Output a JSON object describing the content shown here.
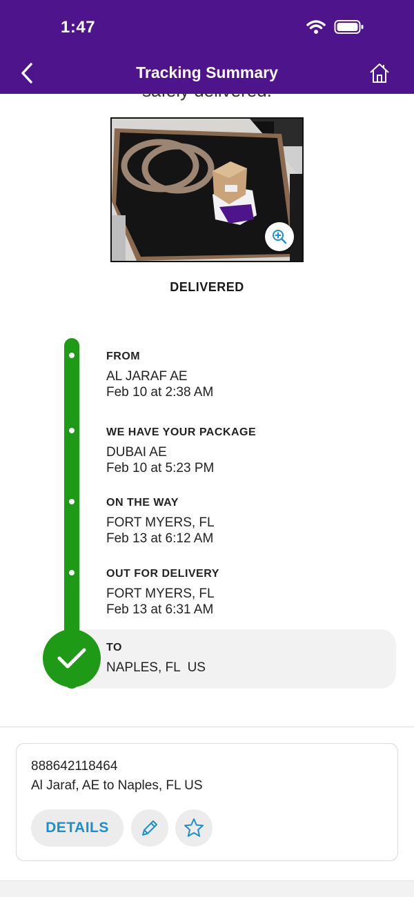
{
  "status_bar": {
    "time": "1:47"
  },
  "nav": {
    "title": "Tracking Summary",
    "back_icon": "chevron-left-icon",
    "home_icon": "home-icon"
  },
  "delivery": {
    "partial_heading": "safely delivered.",
    "status": "DELIVERED"
  },
  "timeline": {
    "steps": [
      {
        "label": "FROM",
        "location": "AL JARAF AE",
        "time": "Feb 10 at 2:38 AM"
      },
      {
        "label": "WE HAVE YOUR PACKAGE",
        "location": "DUBAI AE",
        "time": "Feb 10 at 5:23 PM"
      },
      {
        "label": "ON THE WAY",
        "location": "FORT MYERS, FL",
        "time": "Feb 13 at 6:12 AM"
      },
      {
        "label": "OUT FOR DELIVERY",
        "location": "FORT MYERS, FL",
        "time": "Feb 13 at 6:31 AM"
      },
      {
        "label": "TO",
        "location": "NAPLES, FL  US"
      }
    ]
  },
  "shipment_card": {
    "tracking_number": "888642118464",
    "route": "Al Jaraf, AE to Naples, FL US",
    "details_label": "DETAILS"
  },
  "colors": {
    "header": "#4d148c",
    "timeline": "#1e9a16",
    "link": "#1b8fd1"
  }
}
